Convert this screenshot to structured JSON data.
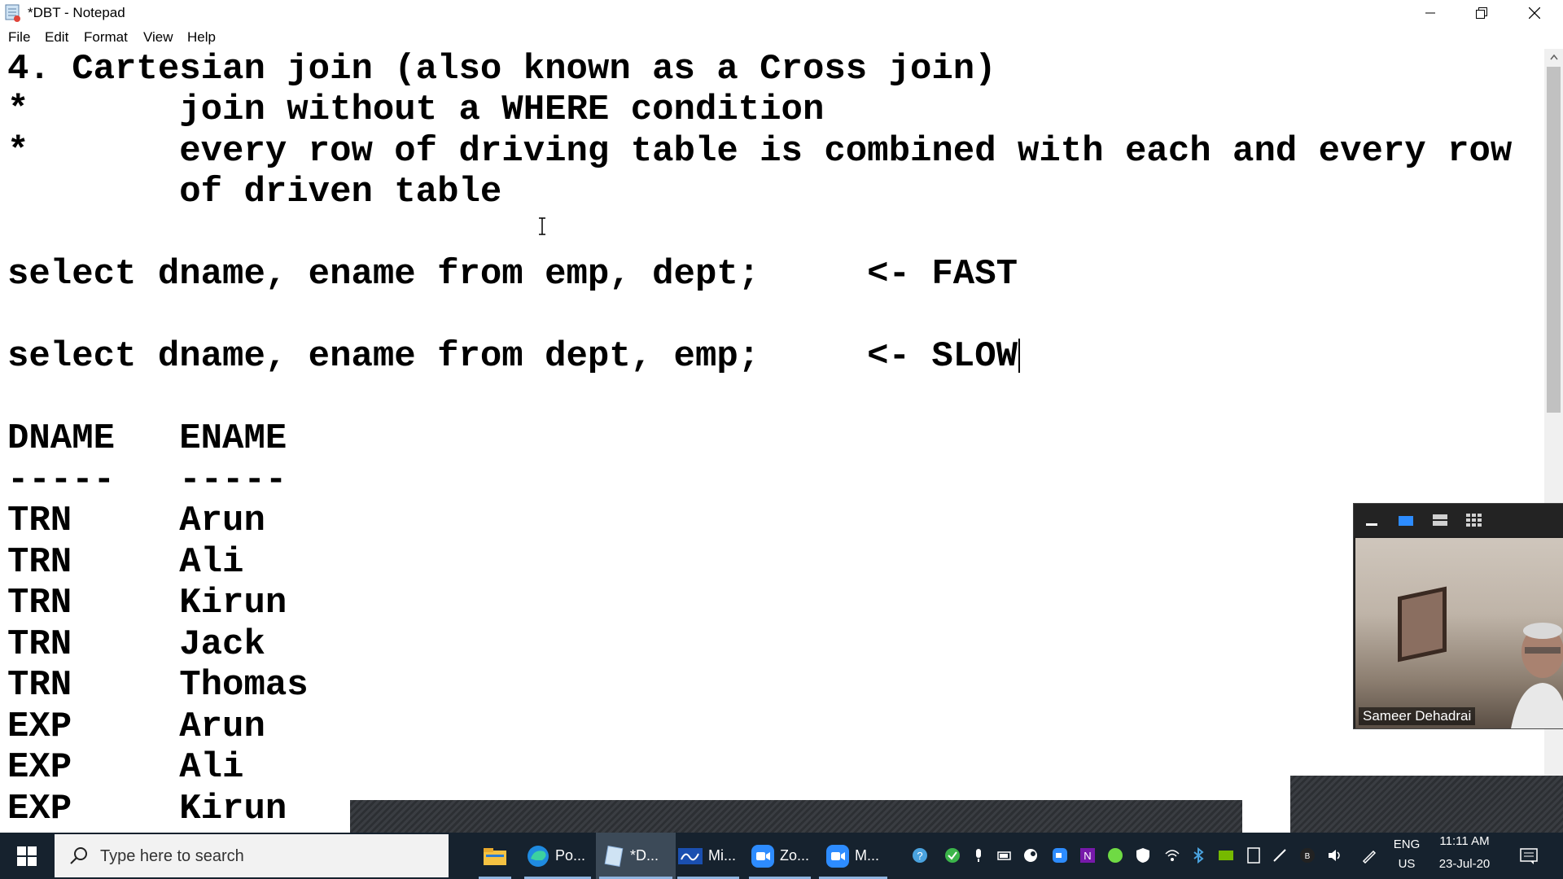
{
  "window": {
    "title": "*DBT - Notepad",
    "app_icon": "notepad-icon",
    "controls": [
      "minimize-icon",
      "restore-icon",
      "close-icon"
    ]
  },
  "menu": {
    "items": [
      "File",
      "Edit",
      "Format",
      "View",
      "Help"
    ]
  },
  "editor": {
    "lines": [
      "4. Cartesian join (also known as a Cross join)",
      "*       join without a WHERE condition",
      "*       every row of driving table is combined with each and every row",
      "        of driven table",
      "",
      "select dname, ename from emp, dept;     <- FAST",
      "",
      "select dname, ename from dept, emp;     <- SLOW",
      "",
      "DNAME   ENAME",
      "-----   -----",
      "TRN     Arun",
      "TRN     Ali",
      "TRN     Kirun",
      "TRN     Jack",
      "TRN     Thomas",
      "EXP     Arun",
      "EXP     Ali",
      "EXP     Kirun"
    ]
  },
  "video_panel": {
    "participant_name": "Sameer Dehadrai",
    "toolbar_icons": [
      "minimize-video-icon",
      "speaker-view-icon",
      "strip-view-icon",
      "gallery-view-icon"
    ]
  },
  "taskbar": {
    "search_placeholder": "Type here to search",
    "apps": [
      {
        "icon": "file-explorer-icon",
        "label": ""
      },
      {
        "icon": "edge-icon",
        "label": "Po..."
      },
      {
        "icon": "notepad-icon",
        "label": "*D..."
      },
      {
        "icon": "whiteboard-icon",
        "label": "Mi..."
      },
      {
        "icon": "zoom-icon",
        "label": "Zo..."
      },
      {
        "icon": "zoom-meeting-icon",
        "label": "M..."
      }
    ],
    "tray": {
      "language": "ENG",
      "region": "US",
      "time": "11:11 AM",
      "date": "23-Jul-20"
    },
    "colors": {
      "taskbar": "#16222e",
      "accent": "#0078d7"
    }
  }
}
